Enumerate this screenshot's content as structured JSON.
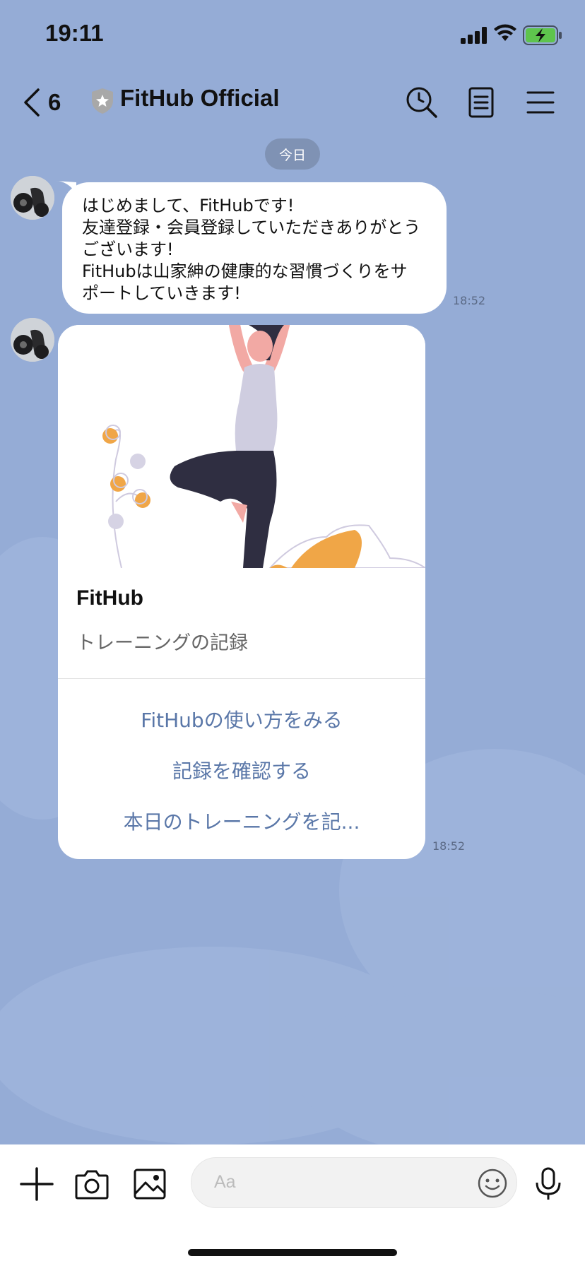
{
  "status_bar": {
    "time": "19:11"
  },
  "header": {
    "back_count": "6",
    "title": "FitHub Official",
    "icons": [
      "back-chevron-icon",
      "shield-icon",
      "search-icon",
      "notes-icon",
      "menu-icon"
    ]
  },
  "date_chip": "今日",
  "messages": [
    {
      "text": "はじめまして、FitHubです!\n友達登録・会員登録していただきありがとうございます!\nFitHubは山家紳の健康的な習慣づくりをサポートしていきます!",
      "lines": [
        "はじめまして、FitHubです!",
        "友達登録・会員登録していただきありがとう",
        "ございます!",
        "FitHubは山家紳の健康的な習慣づくりをサ",
        "ポートしていきます!"
      ],
      "time": "18:52"
    }
  ],
  "card": {
    "title": "FitHub",
    "subtitle": "トレーニングの記録",
    "actions": [
      "FitHubの使い方をみる",
      "記録を確認する",
      "本日のトレーニングを記..."
    ],
    "time": "18:52"
  },
  "input_bar": {
    "placeholder": "Aa",
    "icons": [
      "plus-icon",
      "camera-icon",
      "image-icon",
      "emoji-icon",
      "microphone-icon"
    ]
  },
  "colors": {
    "background": "#95acd6",
    "link": "#5a77a8",
    "accent_orange": "#f0a647"
  }
}
